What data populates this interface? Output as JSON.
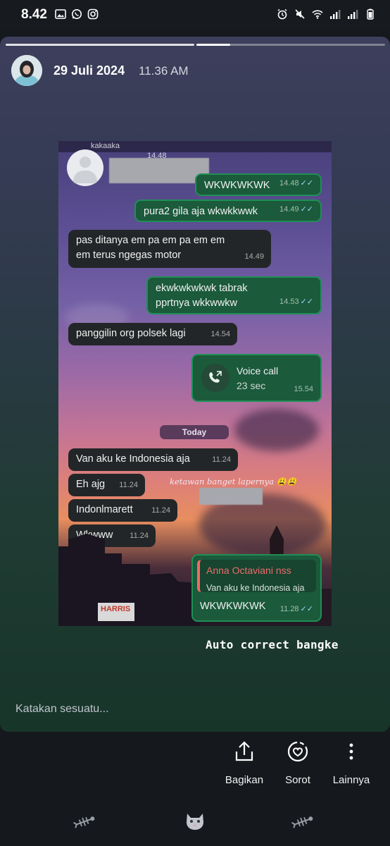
{
  "status_bar": {
    "time": "8.42",
    "left_icons": [
      "image-icon",
      "whatsapp-icon",
      "instagram-icon"
    ],
    "right_icons": [
      "alarm-icon",
      "mute-icon",
      "wifi-icon",
      "signal-icon",
      "signal-icon",
      "battery-icon"
    ]
  },
  "story": {
    "date": "29 Juli 2024",
    "time": "11.36 AM",
    "progress": [
      1.0,
      0.18
    ],
    "caption": "Auto correct bangke",
    "reply_placeholder": "Katakan sesuatu..."
  },
  "chat": {
    "top_cut_text": "kakaaka",
    "top_cut_time": "14.48",
    "messages": [
      {
        "dir": "out",
        "text": "WKWKWKWK",
        "time": "14.48"
      },
      {
        "dir": "out",
        "text": "pura2 gila aja wkwkkwwk",
        "time": "14.49"
      },
      {
        "dir": "in",
        "text": "pas ditanya em pa em pa em em em terus ngegas  motor",
        "time": "14.49"
      },
      {
        "dir": "out",
        "text": "ekwkwkwkwk tabrak pprtnya wkkwwkw",
        "time": "14.53"
      },
      {
        "dir": "in",
        "text": "panggilin org polsek lagi",
        "time": "14.54"
      },
      {
        "dir": "out",
        "type": "call",
        "title": "Voice call",
        "subtitle": "23 sec",
        "time": "15.54"
      },
      {
        "dir": "in",
        "text": "Van aku ke Indonesia aja",
        "time": "11.24"
      },
      {
        "dir": "in",
        "text": "Eh ajg",
        "time": "11.24"
      },
      {
        "dir": "in",
        "text": "Indonlmarett",
        "time": "11.24"
      },
      {
        "dir": "in",
        "text": "Wkwww",
        "time": "11.24"
      },
      {
        "dir": "out",
        "type": "reply",
        "quote_name": "Anna Octaviani nss",
        "quote_text": "Van aku ke Indonesia aja",
        "text": "WKWKWKWK",
        "time": "11.28"
      }
    ],
    "day_label": "Today",
    "handwritten_note": "ketawan banget lapernya 😩😩",
    "sign_text": "HARRIS"
  },
  "actions": [
    {
      "label": "Bagikan",
      "icon": "share-icon"
    },
    {
      "label": "Sorot",
      "icon": "highlight-heart-icon"
    },
    {
      "label": "Lainnya",
      "icon": "more-vertical-icon"
    }
  ],
  "bottom_bar": [
    "fish-bone-icon",
    "cat-icon",
    "fish-bone-icon"
  ],
  "colors": {
    "outgoing_bubble": "#1b5a3b",
    "incoming_bubble": "#232628",
    "quote_accent": "#ef6b6b",
    "ticks": "#9bd7ff"
  }
}
